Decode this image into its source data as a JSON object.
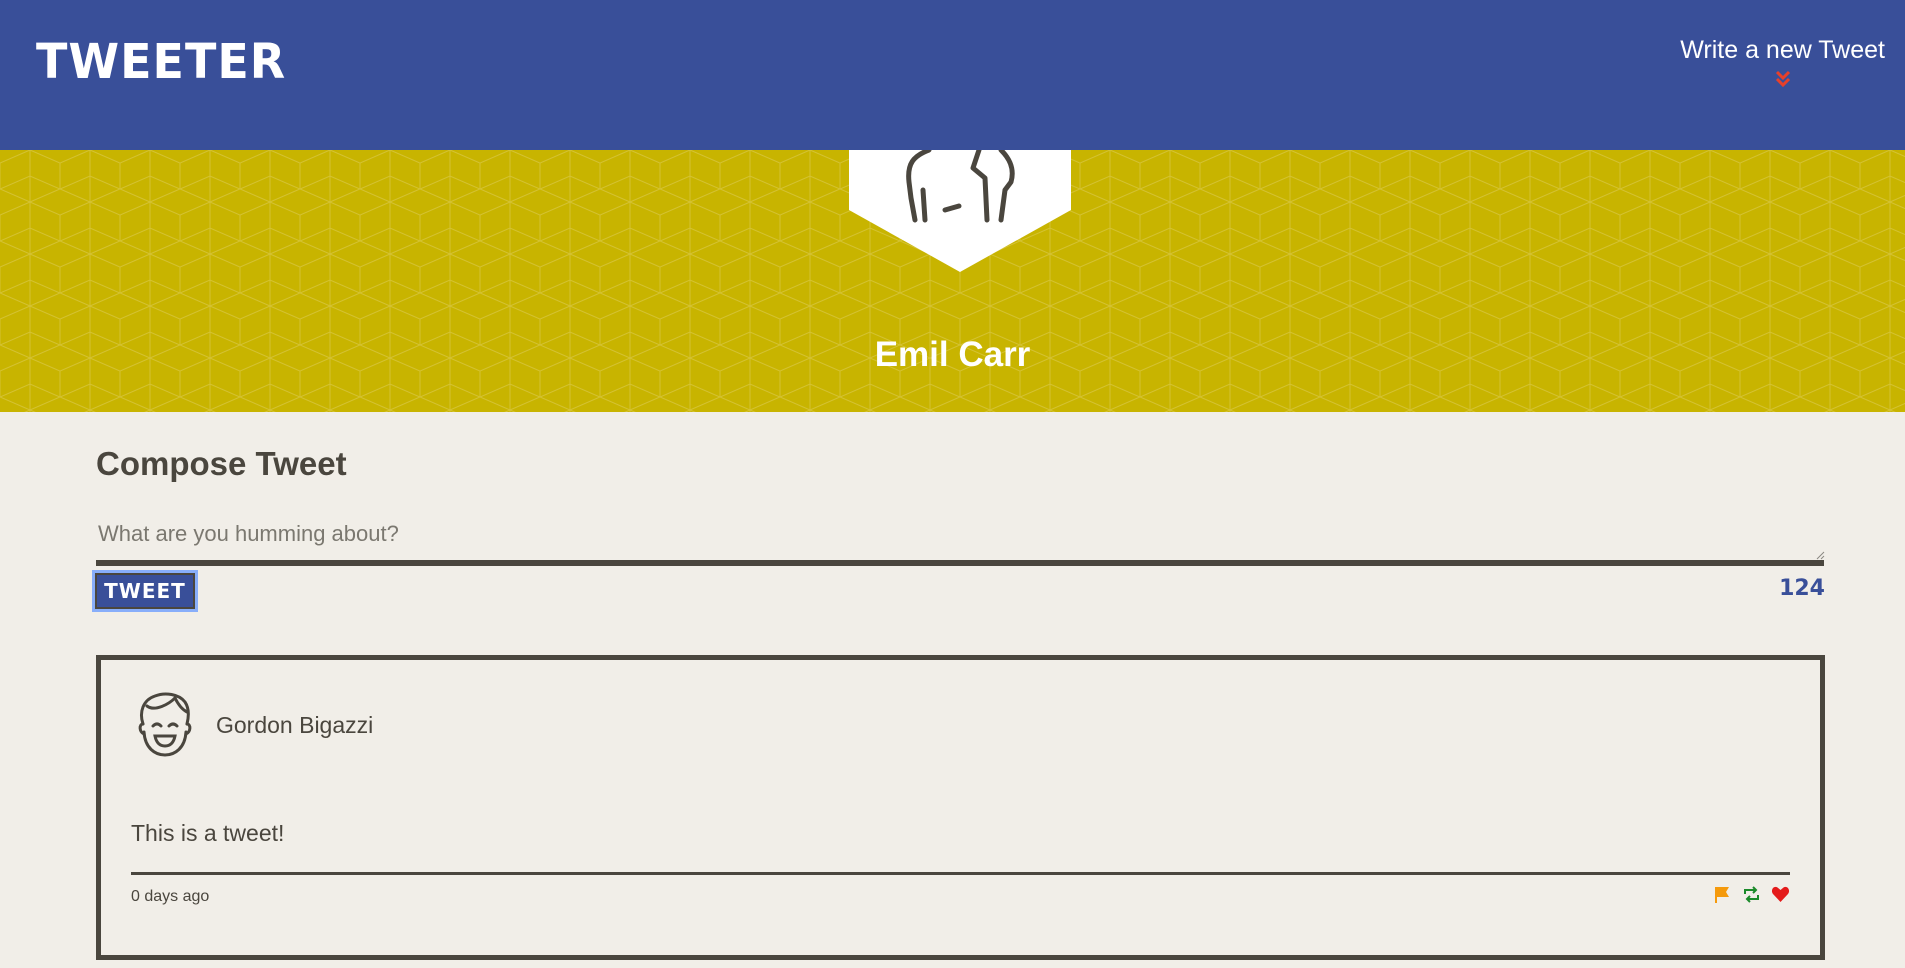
{
  "nav": {
    "logo": "TWEETER",
    "cta_label": "Write a new Tweet",
    "cta_icon": "double-chevron-down-icon",
    "bg_color": "#394f99",
    "chevron_color": "#e8402a"
  },
  "profile": {
    "name": "Emil Carr",
    "avatar_icon": "person-icon",
    "bg_color": "#c8b400"
  },
  "compose": {
    "title": "Compose Tweet",
    "placeholder": "What are you humming about?",
    "button_label": "TWEET",
    "counter": "124"
  },
  "tweets": [
    {
      "user": "Gordon Bigazzi",
      "avatar_icon": "smiling-face-avatar-icon",
      "text": "This is a tweet!",
      "time": "0 days ago",
      "actions": [
        "flag-icon",
        "retweet-icon",
        "heart-icon"
      ],
      "action_colors": [
        "#f59a0c",
        "#1b8a2a",
        "#e41b1b"
      ]
    }
  ]
}
